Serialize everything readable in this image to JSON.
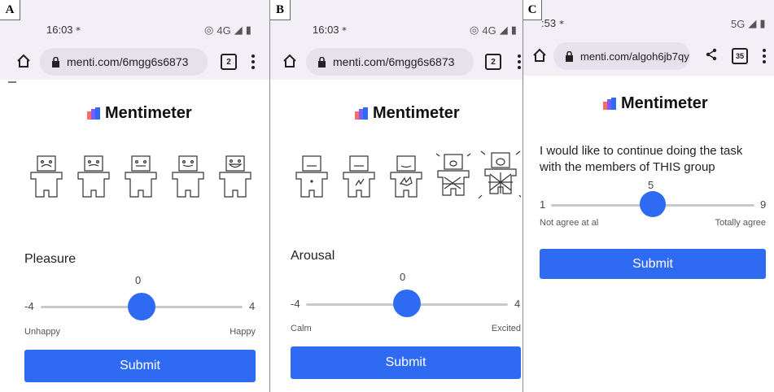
{
  "panels": [
    {
      "label": "A",
      "time": "16:03",
      "network": "4G",
      "url": "menti.com/6mgg6s6873",
      "tabs": "2",
      "logo_text": "Mentimeter",
      "figure_icon": "sam-pleasure-figures-icon",
      "question": "Pleasure",
      "slider": {
        "min": "-4",
        "max": "4",
        "value": "0",
        "value_num": 0,
        "min_num": -4,
        "max_num": 4
      },
      "left_label": "Unhappy",
      "right_label": "Happy",
      "submit": "Submit"
    },
    {
      "label": "B",
      "time": "16:03",
      "network": "4G",
      "url": "menti.com/6mgg6s6873",
      "tabs": "2",
      "logo_text": "Mentimeter",
      "figure_icon": "sam-arousal-figures-icon",
      "question": "Arousal",
      "slider": {
        "min": "-4",
        "max": "4",
        "value": "0",
        "value_num": 0,
        "min_num": -4,
        "max_num": 4
      },
      "left_label": "Calm",
      "right_label": "Excited",
      "submit": "Submit"
    },
    {
      "label": "C",
      "time": ":53",
      "network": "5G",
      "url": "menti.com/algoh6jb7qy",
      "tabs": "35",
      "logo_text": "Mentimeter",
      "question": "I would like to continue doing the task with the members of THIS group",
      "slider": {
        "min": "1",
        "max": "9",
        "value": "5",
        "value_num": 5,
        "min_num": 1,
        "max_num": 9
      },
      "left_label": "Not agree at al",
      "right_label": "Totally agree",
      "submit": "Submit"
    }
  ],
  "colors": {
    "accent": "#2f6bf2",
    "header_bg": "#f3eff6",
    "urlbar_bg": "#e6e1ea"
  }
}
